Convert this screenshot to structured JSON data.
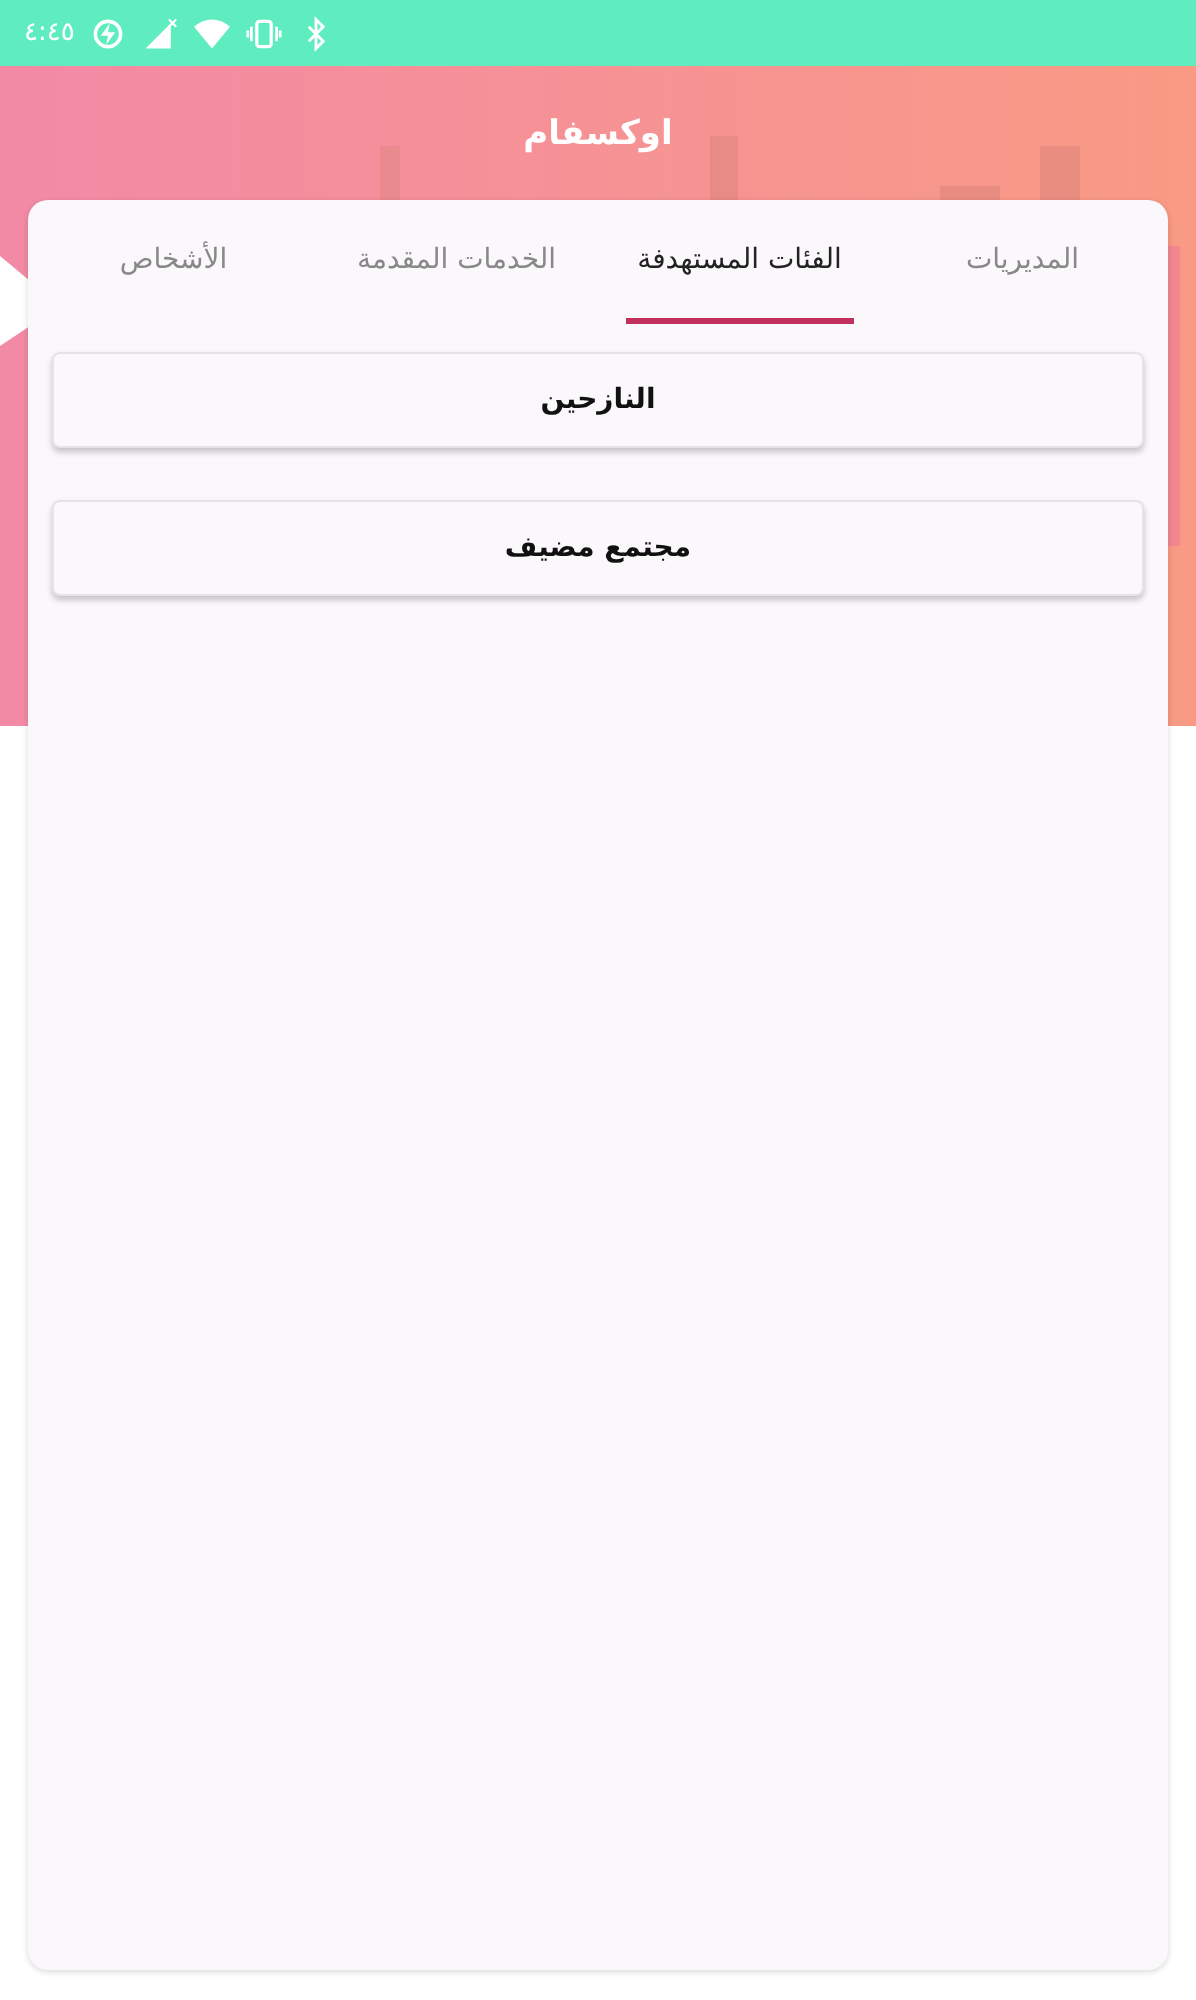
{
  "status_bar": {
    "time": "٤:٤٥"
  },
  "header": {
    "title": "اوكسفام"
  },
  "tabs": [
    {
      "label": "المديريات",
      "selected": false
    },
    {
      "label": "الفئات المستهدفة",
      "selected": true
    },
    {
      "label": "الخدمات المقدمة",
      "selected": false
    },
    {
      "label": "الأشخاص",
      "selected": false
    }
  ],
  "items": [
    {
      "label": "النازحين"
    },
    {
      "label": "مجتمع مضيف"
    }
  ]
}
